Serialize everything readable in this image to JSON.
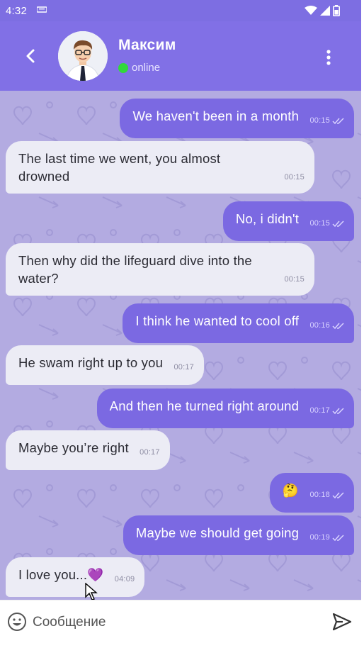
{
  "status_bar": {
    "time": "4:32",
    "icons": [
      "notification-icon",
      "wifi-icon",
      "signal-icon",
      "battery-icon"
    ]
  },
  "header": {
    "contact_name": "Максим",
    "status": "online",
    "status_color": "#31d93a",
    "icons": [
      "back-arrow-icon",
      "avatar",
      "more-vert-icon"
    ]
  },
  "colors": {
    "header_bg": "#8170e6",
    "outgoing_bubble": "#7b69e2",
    "incoming_bubble": "#ececf5",
    "chat_bg": "#b3abe1"
  },
  "messages": [
    {
      "direction": "out",
      "text": "We haven't been in a month",
      "time": "00:15",
      "read": true
    },
    {
      "direction": "in",
      "text": "The last time we went, you almost drowned",
      "time": "00:15"
    },
    {
      "direction": "out",
      "text": "No, i didn't",
      "time": "00:15",
      "read": true
    },
    {
      "direction": "in",
      "text": "Then why did the lifeguard dive into the water?",
      "time": "00:15"
    },
    {
      "direction": "out",
      "text": "I think he wanted to cool off",
      "time": "00:16",
      "read": true
    },
    {
      "direction": "in",
      "text": "He swam right up to you",
      "time": "00:17"
    },
    {
      "direction": "out",
      "text": "And then he turned right around",
      "time": "00:17",
      "read": true
    },
    {
      "direction": "in",
      "text": "Maybe you’re right",
      "time": "00:17"
    },
    {
      "direction": "out",
      "text": "🤔",
      "time": "00:18",
      "read": true
    },
    {
      "direction": "out",
      "text": "Maybe we should get going",
      "time": "00:19",
      "read": true
    },
    {
      "direction": "in",
      "text": "I love you...💜",
      "time": "04:09"
    }
  ],
  "composer": {
    "placeholder": "Сообщение",
    "icons": [
      "emoji-icon",
      "send-icon"
    ]
  }
}
